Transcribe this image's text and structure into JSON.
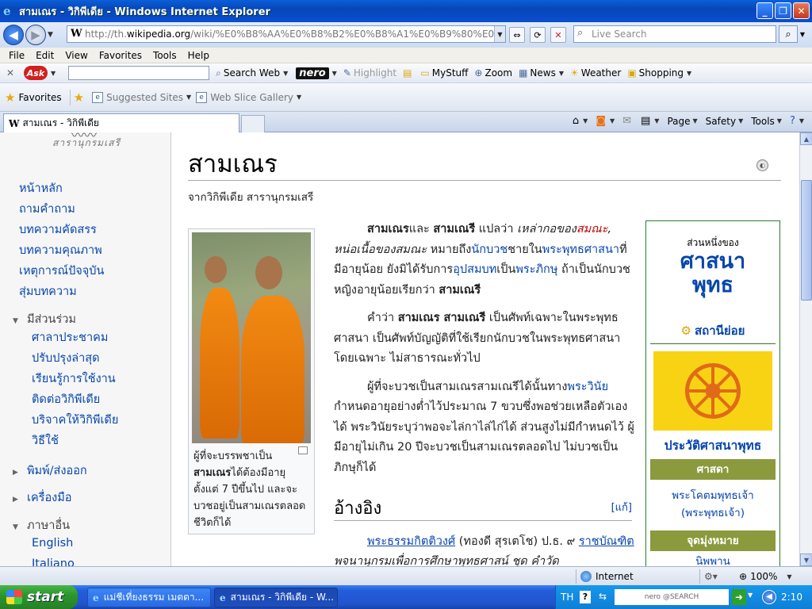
{
  "window": {
    "title": "สามเณร - วิกิพีเดีย - Windows Internet Explorer",
    "buttons": {
      "minimize": "_",
      "maximize": "❐",
      "close": "✕"
    }
  },
  "address": {
    "url_prefix": "http://th.",
    "url_host": "wikipedia.org",
    "url_rest": "/wiki/%E0%B8%AA%E0%B8%B2%E0%B8%A1%E0%B9%80%E0%B8%93%E0%",
    "search_placeholder": "Live Search"
  },
  "menu": [
    "File",
    "Edit",
    "View",
    "Favorites",
    "Tools",
    "Help"
  ],
  "ask_toolbar": {
    "logo": "Ask",
    "search_web": "Search Web",
    "nero": "nero",
    "highlight": "Highlight",
    "mystuff": "MyStuff",
    "zoom": "Zoom",
    "news": "News",
    "weather": "Weather",
    "shopping": "Shopping"
  },
  "favorites_bar": {
    "favorites": "Favorites",
    "suggested": "Suggested Sites",
    "webslice": "Web Slice Gallery"
  },
  "tab": {
    "label": "สามเณร - วิกิพีเดีย"
  },
  "command_bar": {
    "page": "Page",
    "safety": "Safety",
    "tools": "Tools"
  },
  "sidebar": {
    "logo_text": "สารานุกรมเสรี",
    "nav": [
      "หน้าหลัก",
      "ถามคำถาม",
      "บทความคัดสรร",
      "บทความคุณภาพ",
      "เหตุการณ์ปัจจุบัน",
      "สุ่มบทความ"
    ],
    "participate_heading": "มีส่วนร่วม",
    "participate": [
      "ศาลาประชาคม",
      "ปรับปรุงล่าสุด",
      "เรียนรู้การใช้งาน",
      "ติดต่อวิกิพีเดีย",
      "บริจาคให้วิกิพีเดีย",
      "วิธีใช้"
    ],
    "print_heading": "พิมพ์/ส่งออก",
    "tools_heading": "เครื่องมือ",
    "languages_heading": "ภาษาอื่น",
    "languages": [
      "English",
      "Italiano"
    ]
  },
  "article": {
    "title": "สามเณร",
    "from": "จากวิกิพีเดีย สารานุกรมเสรี",
    "caption_1": "ผู้ที่จะบรรพชาเป็น",
    "caption_bold": "สามเณร",
    "caption_2": "ได้ต้องมีอายุตั้งแต่ 7 ปีขึ้นไป และจะบวชอยู่เป็นสามเณรตลอดชีวิตก็ได้",
    "p1": {
      "b1": "สามเณร",
      "t1": "และ ",
      "b2": "สามเณรี",
      "t2": " แปลว่า ",
      "i1": "เหล่ากอของ",
      "r1": "สมณะ",
      "i2": ", หน่อเนื้อของสมณะ",
      "t3": " หมายถึง",
      "a1": "นักบวช",
      "t4": "ชายใน",
      "a2": "พระพุทธศาสนา",
      "t5": "ที่มีอายุน้อย ยังมิได้รับการ",
      "a3": "อุปสมบท",
      "t6": "เป็น",
      "a4": "พระภิกษุ",
      "t7": " ถ้าเป็นนักบวชหญิงอายุน้อยเรียกว่า ",
      "b3": "สามเณรี"
    },
    "p2": {
      "t1": "คำว่า ",
      "b1": "สามเณร สามเณรี",
      "t2": " เป็นศัพท์เฉพาะในพระพุทธศาสนา เป็นศัพท์บัญญัติที่ใช้เรียกนักบวชในพระพุทธศาสนาโดยเฉพาะ ไม่สาธารณะทั่วไป"
    },
    "p3": {
      "t1": "ผู้ที่จะบวชเป็นสามเณรสามเณรีได้นั้นทาง",
      "a1": "พระวินัย",
      "t2": "กำหนดอายุอย่างต่ำไว้ประมาณ 7 ขวบซึ่งพอช่วยเหลือตัวเองได้ พระวินัยระบุว่าพอจะไล่กาไล่ไก่ได้ ส่วนสูงไม่มีกำหนดไว้ ผู้มีอายุไม่เกิน 20 ปีจะบวชเป็นสามเณรตลอดไป ไม่บวชเป็นภิกษุก็ได้"
    },
    "refs_heading": "อ้างอิง",
    "refs_edit": "[แก้]",
    "ref1": {
      "a1": "พระธรรมกิตติวงศ์",
      "t1": " (ทองดี สุรเตโช) ป.ธ. ๙ ",
      "a2": "ราชบัณฑิต",
      "t2": " พจนานุกรมเพื่อการศึกษาพุทธศาสน์ ชุด คำวัด"
    }
  },
  "infobox": {
    "part_of": "ส่วนหนึ่งของ",
    "topic": "ศาสนาพุทธ",
    "portal": "สถานีย่อย",
    "history": "ประวัติศาสนาพุทธ",
    "sec1": "ศาสดา",
    "sec1_link1": "พระโคตมพุทธเจ้า",
    "sec1_link2": "(พระพุทธเจ้า)",
    "sec2": "จุดมุ่งหมาย",
    "sec2_link1": "นิพพาน"
  },
  "status": {
    "zone": "Internet",
    "zoom": "100%"
  },
  "taskbar": {
    "start": "start",
    "task1": "แม่ชีเที่ยงธรรม เมตตา...",
    "task2": "สามเณร - วิกิพีเดีย - W...",
    "lang": "TH",
    "help": "?",
    "search": "nero @SEARCH",
    "clock": "2:10"
  },
  "colors": {
    "link": "#0645ad",
    "redlink": "#ba0000",
    "infobox_border": "#2c7d2c",
    "infobox_bar": "#8a9a3d",
    "flag": "#f8d313",
    "wheel": "#e06a1a"
  }
}
